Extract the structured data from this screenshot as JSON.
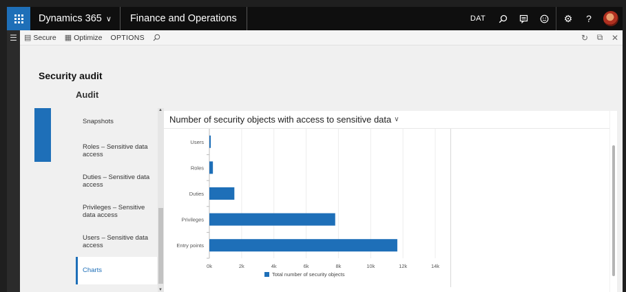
{
  "topbar": {
    "brand": "Dynamics 365",
    "module": "Finance and Operations",
    "company": "DAT"
  },
  "actionpane": {
    "secure": "Secure",
    "optimize": "Optimize",
    "options": "OPTIONS"
  },
  "page": {
    "title": "Security audit",
    "section": "Audit"
  },
  "tabs": [
    "Snapshots",
    "Roles – Sensitive data access",
    "Duties – Sensitive data access",
    "Privileges – Sensitive data access",
    "Users – Sensitive data access",
    "Charts"
  ],
  "active_tab": "Charts",
  "chart": {
    "title": "Number of security objects with access to sensitive data"
  },
  "chart_data": {
    "type": "bar",
    "orientation": "horizontal",
    "title": "Number of security objects with access to sensitive data",
    "categories": [
      "Users",
      "Roles",
      "Duties",
      "Privileges",
      "Entry points"
    ],
    "series": [
      {
        "name": "Total number of security objects",
        "values": [
          80,
          220,
          1550,
          7800,
          11650
        ]
      }
    ],
    "xticks": [
      "0k",
      "2k",
      "4k",
      "6k",
      "8k",
      "10k",
      "12k",
      "14k"
    ],
    "xlim": [
      0,
      14000
    ],
    "grid": true,
    "legend": "bottom",
    "color": "#1e6fb8"
  },
  "colors": {
    "accent": "#1e6fb8",
    "topbar": "#0f0f0f"
  }
}
